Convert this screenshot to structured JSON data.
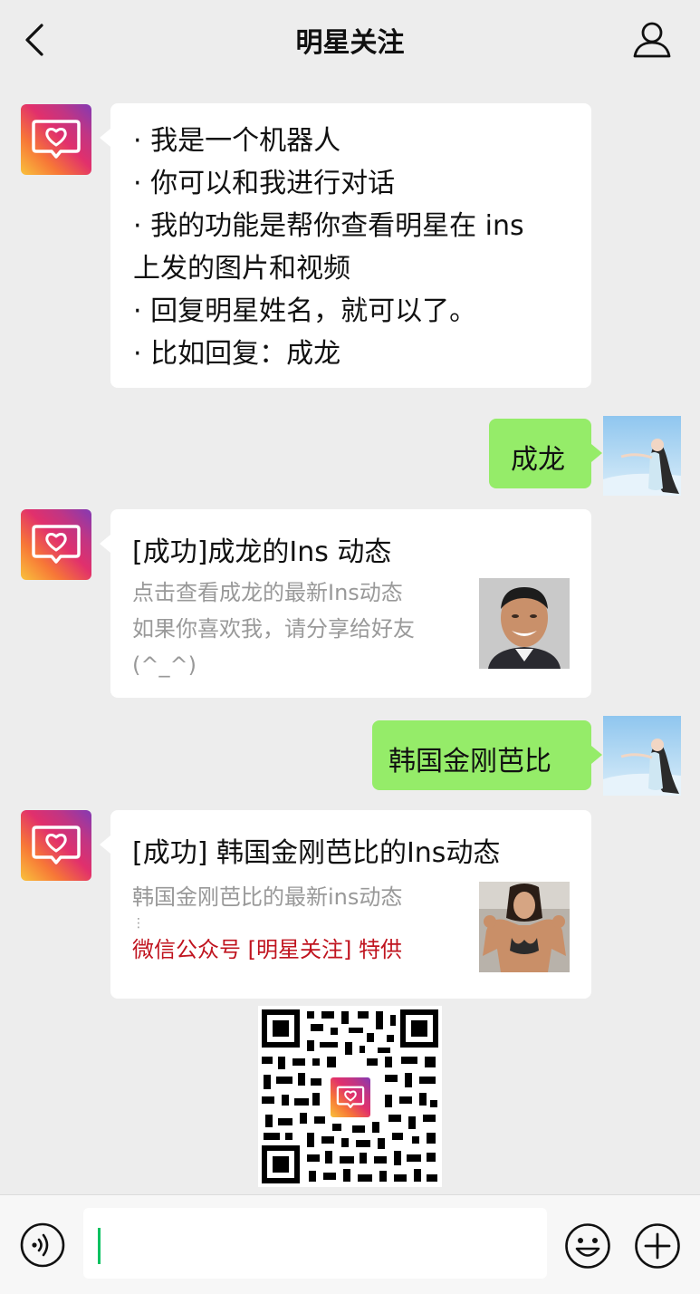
{
  "header": {
    "title": "明星关注"
  },
  "messages": {
    "intro": {
      "lines": [
        "· 我是一个机器人",
        "· 你可以和我进行对话",
        "· 我的功能是帮你查看明星在 ins",
        "上发的图片和视频",
        "· 回复明星姓名，就可以了。",
        "· 比如回复：成龙"
      ]
    },
    "user1": {
      "text": "成龙"
    },
    "card1": {
      "title": "[成功]成龙的Ins 动态",
      "desc": [
        "点击查看成龙的最新Ins动态",
        "如果你喜欢我，请分享给好友",
        "(^_^)"
      ]
    },
    "user2": {
      "text": "韩国金刚芭比"
    },
    "card2": {
      "title": "[成功] 韩国金刚芭比的Ins动态",
      "desc": [
        "韩国金刚芭比的最新ins动态",
        "⋮"
      ],
      "promo": "微信公众号 [明星关注] 特供"
    }
  },
  "colors": {
    "green_bubble": "#95ec69",
    "promo_red": "#c0141f",
    "background": "#ededed"
  },
  "icons": [
    "back-icon",
    "profile-icon",
    "voice-icon",
    "emoji-icon",
    "plus-icon",
    "heart-chat-icon",
    "qr-code-icon"
  ]
}
